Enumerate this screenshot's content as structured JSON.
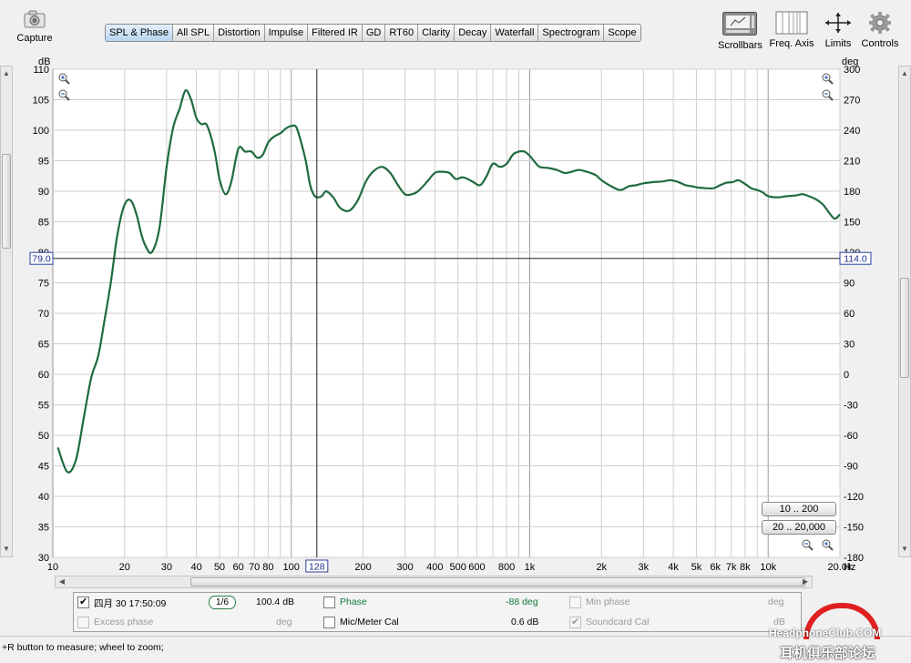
{
  "toolbar": {
    "capture_label": "Capture",
    "tabs": [
      "SPL & Phase",
      "All SPL",
      "Distortion",
      "Impulse",
      "Filtered IR",
      "GD",
      "RT60",
      "Clarity",
      "Decay",
      "Waterfall",
      "Spectrogram",
      "Scope"
    ],
    "active_tab": "SPL & Phase",
    "right_tools": [
      "Scrollbars",
      "Freq. Axis",
      "Limits",
      "Controls"
    ]
  },
  "graph": {
    "left_unit": "dB",
    "right_unit": "deg",
    "x_unit": "Hz",
    "cursor_left_value": "79.0",
    "cursor_right_value": "114.0",
    "cursor_x_value": "128",
    "range_buttons": [
      "10 .. 200",
      "20 .. 20,000"
    ],
    "trace_color": "#1f6b3f"
  },
  "chart_data": {
    "type": "line",
    "title": "",
    "xlabel": "Hz",
    "ylabel": "dB",
    "y2label": "deg",
    "x_scale": "log",
    "xlim": [
      10,
      20000
    ],
    "ylim": [
      30,
      110
    ],
    "y2lim": [
      -180,
      300
    ],
    "yticks": [
      30,
      35,
      40,
      45,
      50,
      55,
      60,
      65,
      70,
      75,
      80,
      85,
      90,
      95,
      100,
      105,
      110
    ],
    "y2ticks": [
      -180,
      -150,
      -120,
      -90,
      -60,
      -30,
      0,
      30,
      60,
      90,
      120,
      150,
      180,
      210,
      240,
      270,
      300
    ],
    "xticks": [
      {
        "v": 10,
        "label": "10"
      },
      {
        "v": 20,
        "label": "20"
      },
      {
        "v": 30,
        "label": "30"
      },
      {
        "v": 40,
        "label": "40"
      },
      {
        "v": 50,
        "label": "50"
      },
      {
        "v": 60,
        "label": "60"
      },
      {
        "v": 70,
        "label": "70"
      },
      {
        "v": 80,
        "label": "80"
      },
      {
        "v": 100,
        "label": "100"
      },
      {
        "v": 200,
        "label": "200"
      },
      {
        "v": 300,
        "label": "300"
      },
      {
        "v": 400,
        "label": "400"
      },
      {
        "v": 500,
        "label": "500"
      },
      {
        "v": 600,
        "label": "600"
      },
      {
        "v": 800,
        "label": "800"
      },
      {
        "v": 1000,
        "label": "1k"
      },
      {
        "v": 2000,
        "label": "2k"
      },
      {
        "v": 3000,
        "label": "3k"
      },
      {
        "v": 4000,
        "label": "4k"
      },
      {
        "v": 5000,
        "label": "5k"
      },
      {
        "v": 6000,
        "label": "6k"
      },
      {
        "v": 7000,
        "label": "7k"
      },
      {
        "v": 8000,
        "label": "8k"
      },
      {
        "v": 10000,
        "label": "10k"
      },
      {
        "v": 20000,
        "label": "20.0k"
      }
    ],
    "grid": true,
    "cursor": {
      "x": 128,
      "y": 79.0
    },
    "series": [
      {
        "x": [
          10.5,
          11.5,
          12.5,
          13.5,
          14.5,
          15.5,
          16.5,
          17.5,
          18.5,
          19.5,
          20.5,
          21.5,
          22.5,
          23.5,
          24.5,
          26,
          28,
          30,
          32,
          34,
          36,
          38,
          40,
          42,
          44,
          46,
          48,
          50,
          53,
          56,
          60,
          64,
          68,
          72,
          76,
          80,
          85,
          90,
          95,
          100,
          105,
          110,
          115,
          120,
          125,
          130,
          135,
          140,
          150,
          160,
          175,
          190,
          205,
          220,
          240,
          260,
          280,
          300,
          320,
          340,
          370,
          400,
          430,
          460,
          490,
          520,
          550,
          580,
          620,
          660,
          700,
          750,
          800,
          850,
          900,
          950,
          1000,
          1050,
          1100,
          1200,
          1300,
          1400,
          1500,
          1600,
          1700,
          1800,
          1900,
          2000,
          2200,
          2400,
          2600,
          2800,
          3000,
          3300,
          3600,
          3900,
          4200,
          4500,
          4800,
          5100,
          5500,
          5900,
          6300,
          6700,
          7100,
          7500,
          8000,
          8500,
          9000,
          9500,
          10000,
          11000,
          12000,
          13000,
          14000,
          15000,
          16000,
          17000,
          18000,
          19000,
          20000
        ],
        "y": [
          48,
          44,
          46,
          53,
          59.5,
          63,
          69,
          75,
          82,
          86.5,
          88.5,
          88.2,
          86,
          83,
          81,
          80,
          84,
          94,
          100.5,
          103.5,
          106.5,
          105,
          102,
          101,
          101,
          99,
          96,
          92,
          89.5,
          91.5,
          97,
          96.5,
          96.5,
          95.5,
          96,
          98,
          99,
          99.5,
          100.3,
          100.7,
          100.5,
          98,
          95,
          91,
          89.3,
          89,
          89.3,
          90,
          89,
          87.3,
          86.8,
          88.5,
          91.5,
          93.2,
          94,
          93,
          91,
          89.5,
          89.5,
          90,
          91.5,
          93,
          93.2,
          93,
          92,
          92.3,
          92,
          91.5,
          91,
          92.5,
          94.5,
          94,
          94.5,
          96,
          96.5,
          96.5,
          95.8,
          94.8,
          94,
          93.8,
          93.5,
          93,
          93.2,
          93.5,
          93.3,
          93,
          92.6,
          91.8,
          90.8,
          90.2,
          90.8,
          91,
          91.3,
          91.5,
          91.6,
          91.8,
          91.5,
          91,
          90.8,
          90.6,
          90.5,
          90.5,
          91,
          91.4,
          91.5,
          91.8,
          91.2,
          90.5,
          90.2,
          89.8,
          89.2,
          89,
          89.2,
          89.3,
          89.5,
          89.1,
          88.6,
          87.8,
          86.5,
          85.5,
          86.2
        ]
      }
    ]
  },
  "info": {
    "row1": {
      "checked": true,
      "name": "四月 30 17:50:09",
      "smoothing": "1/6",
      "spl_value": "100.4 dB",
      "phase_label": "Phase",
      "phase_value": "-88 deg",
      "minphase_label": "Min phase",
      "minphase_unit": "deg"
    },
    "row2": {
      "excess_label": "Excess phase",
      "excess_unit": "deg",
      "mic_label": "Mic/Meter Cal",
      "mic_value": "0.6 dB",
      "soundcard_label": "Soundcard Cal",
      "soundcard_unit": "dB"
    }
  },
  "status": {
    "text": "+R button to measure; wheel to zoom;"
  },
  "watermark": {
    "line1": "HeadphoneClub.COM",
    "line2": "耳机俱乐部论坛"
  }
}
